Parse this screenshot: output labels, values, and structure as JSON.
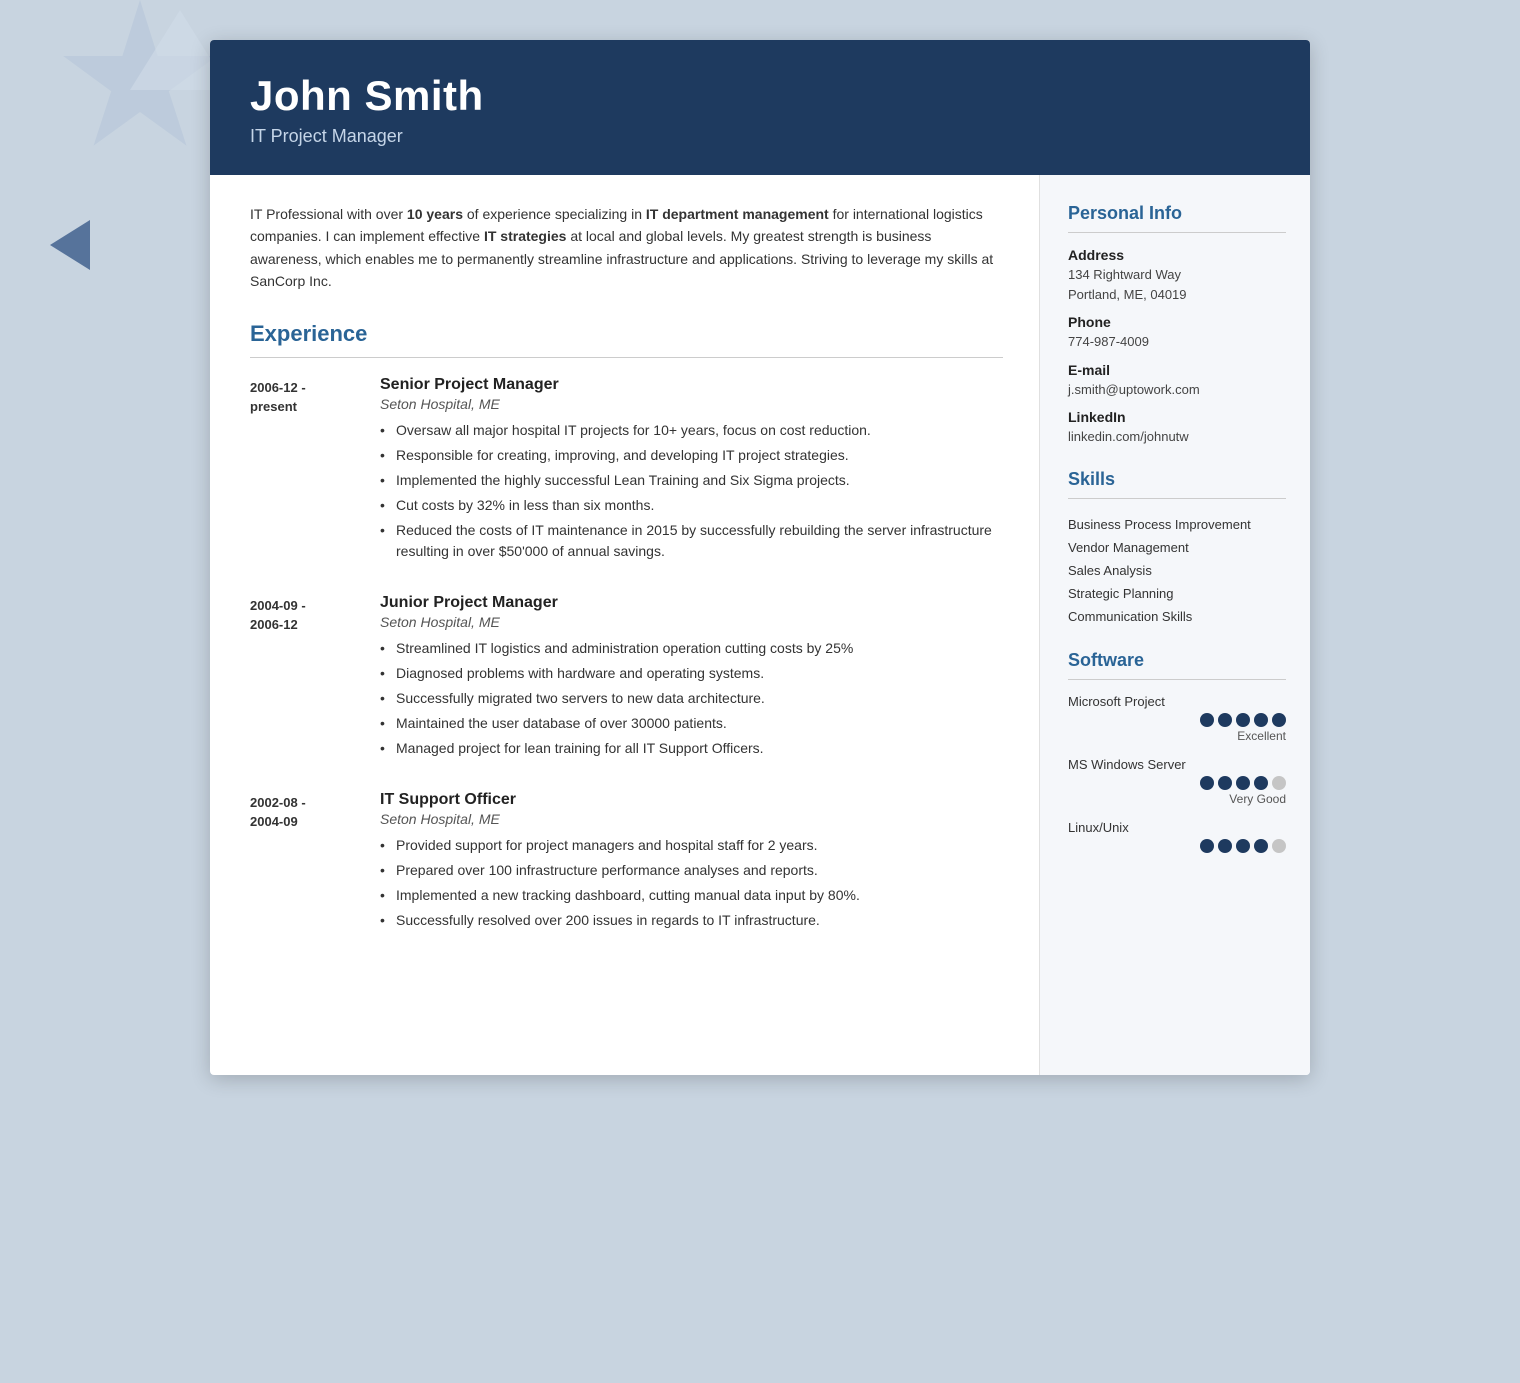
{
  "header": {
    "name": "John Smith",
    "title": "IT Project Manager"
  },
  "summary": {
    "text_parts": [
      {
        "text": "IT Professional with over ",
        "bold": false
      },
      {
        "text": "10 years",
        "bold": true
      },
      {
        "text": " of experience specializing in ",
        "bold": false
      },
      {
        "text": "IT department management",
        "bold": true
      },
      {
        "text": " for international logistics companies. I can implement effective ",
        "bold": false
      },
      {
        "text": "IT strategies",
        "bold": true
      },
      {
        "text": " at local and global levels. My greatest strength is business awareness, which enables me to permanently streamline infrastructure and applications. Striving to leverage my skills at SanCorp Inc.",
        "bold": false
      }
    ]
  },
  "experience": {
    "section_label": "Experience",
    "entries": [
      {
        "dates": "2006-12 -\npresent",
        "job_title": "Senior Project Manager",
        "company": "Seton Hospital, ME",
        "bullets": [
          "Oversaw all major hospital IT projects for 10+ years, focus on cost reduction.",
          "Responsible for creating, improving, and developing IT project strategies.",
          "Implemented the highly successful Lean Training and Six Sigma projects.",
          "Cut costs by 32% in less than six months.",
          "Reduced the costs of IT maintenance in 2015 by successfully rebuilding the server infrastructure resulting in over $50'000 of annual savings."
        ]
      },
      {
        "dates": "2004-09 -\n2006-12",
        "job_title": "Junior Project Manager",
        "company": "Seton Hospital, ME",
        "bullets": [
          "Streamlined IT logistics and administration operation cutting costs by 25%",
          "Diagnosed problems with hardware and operating systems.",
          "Successfully migrated two servers to new data architecture.",
          "Maintained the user database of over 30000 patients.",
          "Managed project for lean training for all IT Support Officers."
        ]
      },
      {
        "dates": "2002-08 -\n2004-09",
        "job_title": "IT Support Officer",
        "company": "Seton Hospital, ME",
        "bullets": [
          "Provided support for project managers and hospital staff for 2 years.",
          "Prepared over 100 infrastructure performance analyses and reports.",
          "Implemented a new tracking dashboard, cutting manual data input by 80%.",
          "Successfully resolved over 200 issues in regards to IT infrastructure."
        ]
      }
    ]
  },
  "personal_info": {
    "section_label": "Personal Info",
    "fields": [
      {
        "label": "Address",
        "value": "134 Rightward Way\nPortland, ME, 04019"
      },
      {
        "label": "Phone",
        "value": "774-987-4009"
      },
      {
        "label": "E-mail",
        "value": "j.smith@uptowork.com"
      },
      {
        "label": "LinkedIn",
        "value": "linkedin.com/johnutw"
      }
    ]
  },
  "skills": {
    "section_label": "Skills",
    "items": [
      "Business Process Improvement",
      "Vendor Management",
      "Sales Analysis",
      "Strategic Planning",
      "Communication Skills"
    ]
  },
  "software": {
    "section_label": "Software",
    "items": [
      {
        "name": "Microsoft Project",
        "filled": 5,
        "total": 5,
        "rating": "Excellent"
      },
      {
        "name": "MS Windows Server",
        "filled": 4,
        "total": 5,
        "rating": "Very Good"
      },
      {
        "name": "Linux/Unix",
        "filled": 4,
        "total": 5,
        "rating": ""
      }
    ]
  }
}
